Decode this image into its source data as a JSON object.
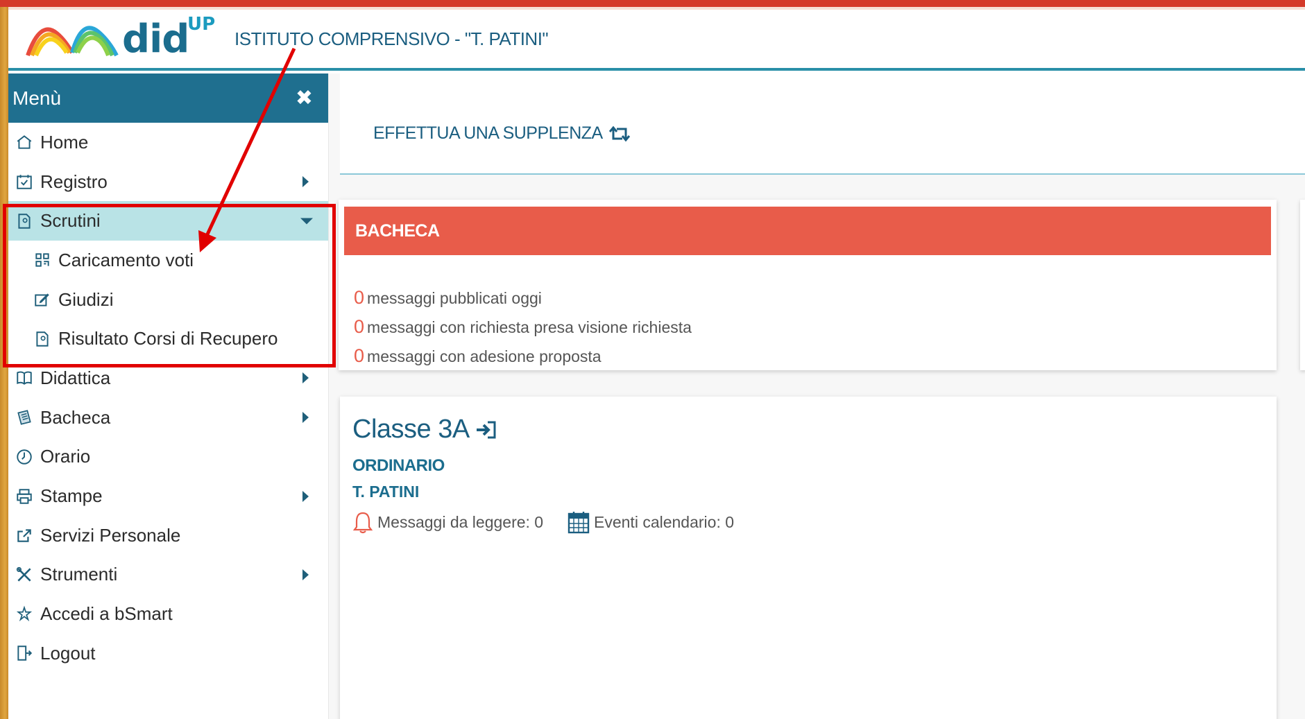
{
  "header": {
    "brand": "did",
    "brand_sup": "UP",
    "school_name": "ISTITUTO COMPRENSIVO - \"T. PATINI\""
  },
  "sidebar": {
    "title": "Menù",
    "close_glyph": "✖",
    "items": [
      {
        "label": "Home",
        "icon": "home-icon"
      },
      {
        "label": "Registro",
        "icon": "calendar-check-icon",
        "has_submenu": true
      },
      {
        "label": "Scrutini",
        "icon": "document-scrutini-icon",
        "expanded": true,
        "active": true
      },
      {
        "label": "Caricamento voti",
        "icon": "qr-grid-icon",
        "sub": true
      },
      {
        "label": "Giudizi",
        "icon": "edit-icon",
        "sub": true
      },
      {
        "label": "Risultato Corsi di Recupero",
        "icon": "document-scrutini-icon",
        "sub": true
      },
      {
        "label": "Didattica",
        "icon": "book-icon",
        "has_submenu": true
      },
      {
        "label": "Bacheca",
        "icon": "newspaper-icon",
        "has_submenu": true
      },
      {
        "label": "Orario",
        "icon": "clock-icon"
      },
      {
        "label": "Stampe",
        "icon": "printer-icon",
        "has_submenu": true
      },
      {
        "label": "Servizi Personale",
        "icon": "share-icon"
      },
      {
        "label": "Strumenti",
        "icon": "tools-icon",
        "has_submenu": true
      },
      {
        "label": "Accedi a bSmart",
        "icon": "star-hand-icon"
      },
      {
        "label": "Logout",
        "icon": "logout-icon"
      }
    ]
  },
  "main": {
    "supplenza_label": "EFFETTUA UNA SUPPLENZA",
    "bacheca": {
      "title": "BACHECA",
      "messages": [
        {
          "count": "0",
          "text": "messaggi pubblicati oggi"
        },
        {
          "count": "0",
          "text": "messaggi con richiesta presa visione richiesta"
        },
        {
          "count": "0",
          "text": "messaggi con adesione proposta"
        }
      ]
    },
    "classe": {
      "title": "Classe 3A",
      "type": "ORDINARIO",
      "school": "T. PATINI",
      "messaggi_label": "Messaggi da leggere: 0",
      "eventi_label": "Eventi calendario: 0"
    }
  },
  "colors": {
    "primary": "#1f6f8f",
    "active_bg": "#b9e3e6",
    "bacheca_red": "#e85c4a",
    "annotation_red": "#e10000"
  }
}
